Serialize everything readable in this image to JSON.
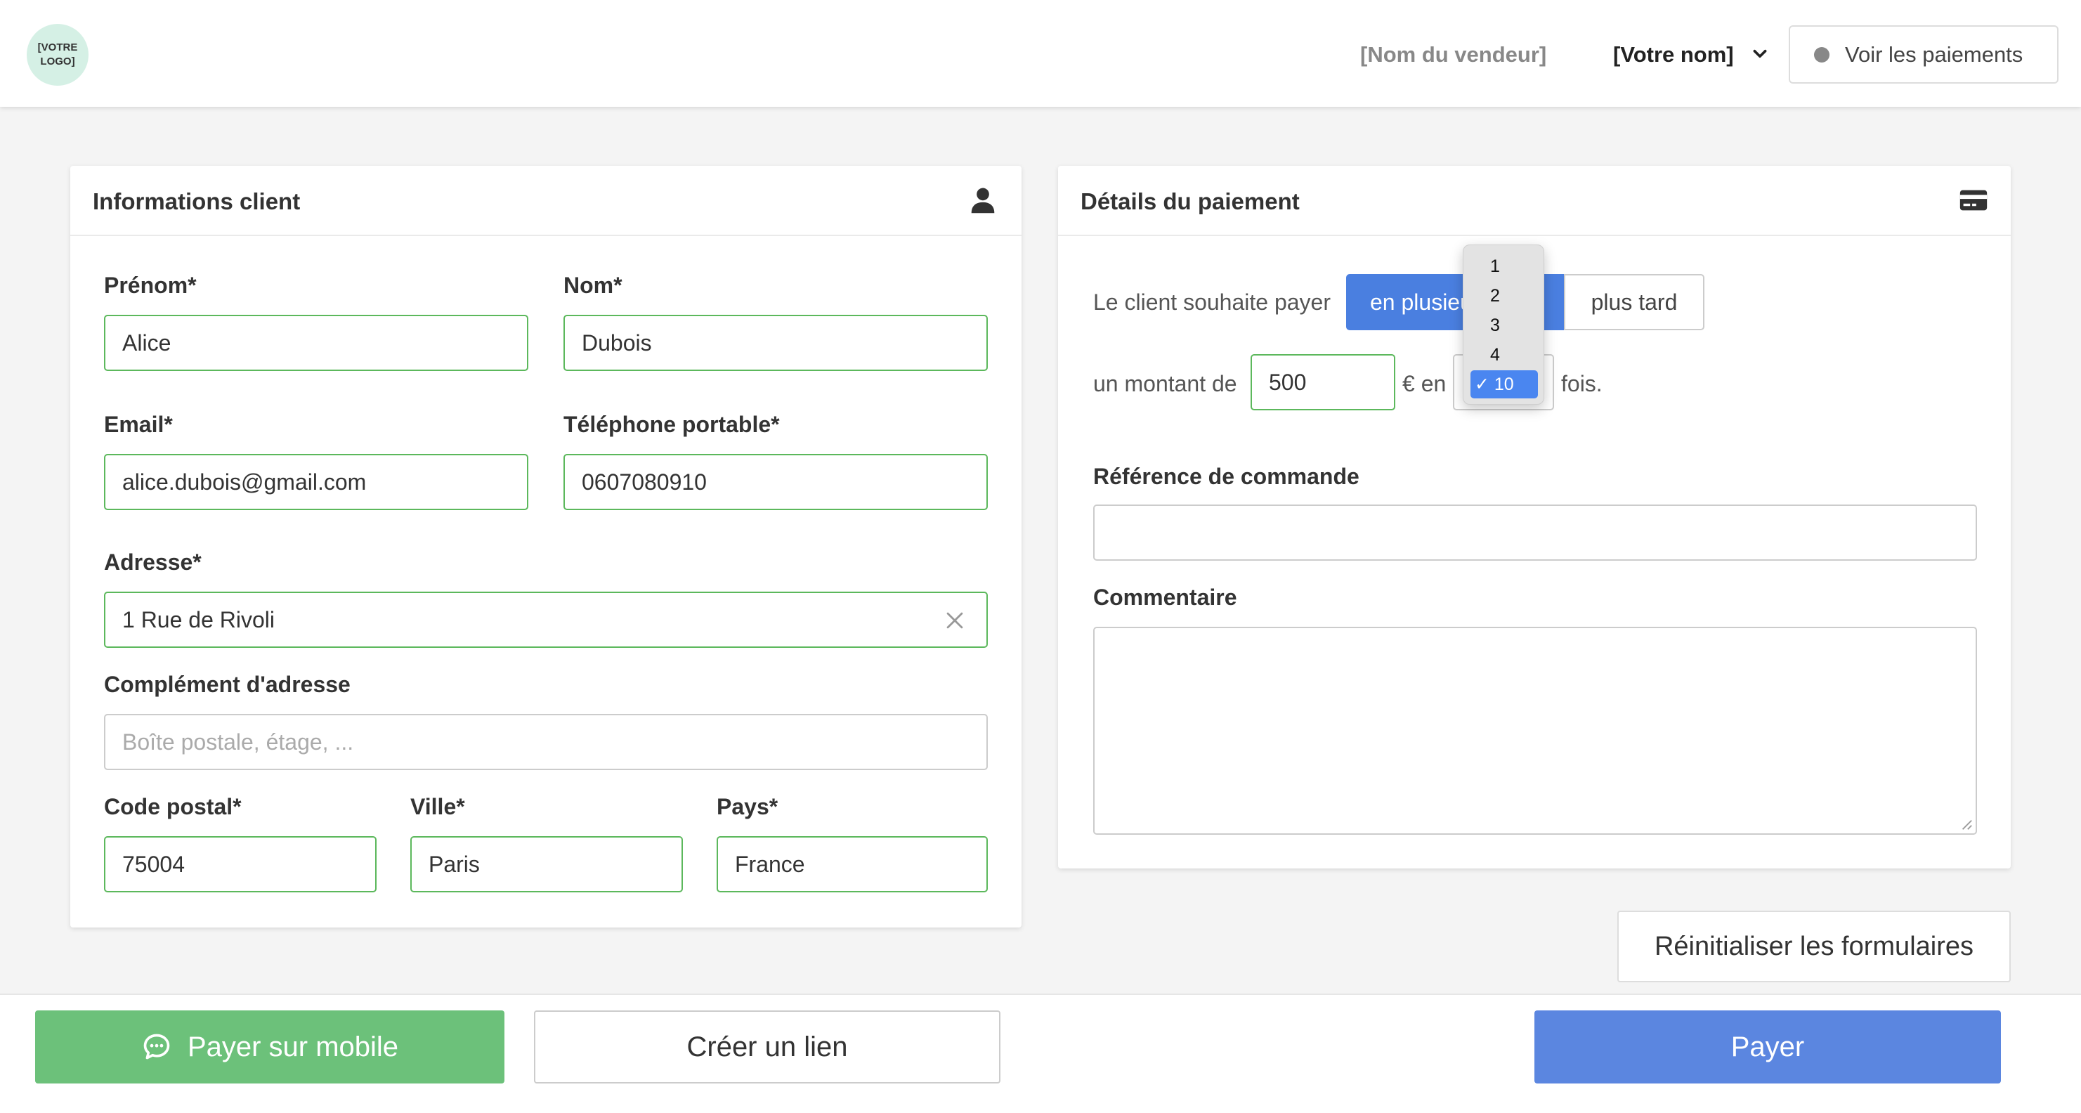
{
  "header": {
    "logo_text": "[VOTRE LOGO]",
    "vendor_name": "[Nom du vendeur]",
    "user_name": "[Votre nom]",
    "payments_button": "Voir les paiements"
  },
  "client_card": {
    "title": "Informations client",
    "fields": {
      "prenom": {
        "label": "Prénom*",
        "value": "Alice"
      },
      "nom": {
        "label": "Nom*",
        "value": "Dubois"
      },
      "email": {
        "label": "Email*",
        "value": "alice.dubois@gmail.com"
      },
      "telephone": {
        "label": "Téléphone portable*",
        "value": "0607080910"
      },
      "adresse": {
        "label": "Adresse*",
        "value": "1 Rue de Rivoli"
      },
      "complement": {
        "label": "Complément d'adresse",
        "value": "",
        "placeholder": "Boîte postale, étage, ..."
      },
      "code_postal": {
        "label": "Code postal*",
        "value": "75004"
      },
      "ville": {
        "label": "Ville*",
        "value": "Paris"
      },
      "pays": {
        "label": "Pays*",
        "value": "France"
      }
    }
  },
  "payment_card": {
    "title": "Détails du paiement",
    "wish_text": "Le client souhaite payer",
    "mode_options": {
      "selected": "en plusieurs fois",
      "other": "plus tard"
    },
    "amount_prefix": "un montant de",
    "amount_value": "500",
    "amount_suffix": "€ en",
    "installments_suffix": "fois.",
    "installments_dropdown": {
      "options": [
        "1",
        "2",
        "3",
        "4",
        "10"
      ],
      "selected": "10",
      "selected_display": "✓ 10"
    },
    "reference": {
      "label": "Référence de commande",
      "value": ""
    },
    "comment": {
      "label": "Commentaire",
      "value": ""
    }
  },
  "actions": {
    "reset": "Réinitialiser les formulaires",
    "pay_mobile": "Payer sur mobile",
    "create_link": "Créer un lien",
    "pay": "Payer"
  },
  "colors": {
    "valid_border": "#5cb85c",
    "primary": "#4a7fe0",
    "mobile_button": "#6cc17a"
  }
}
